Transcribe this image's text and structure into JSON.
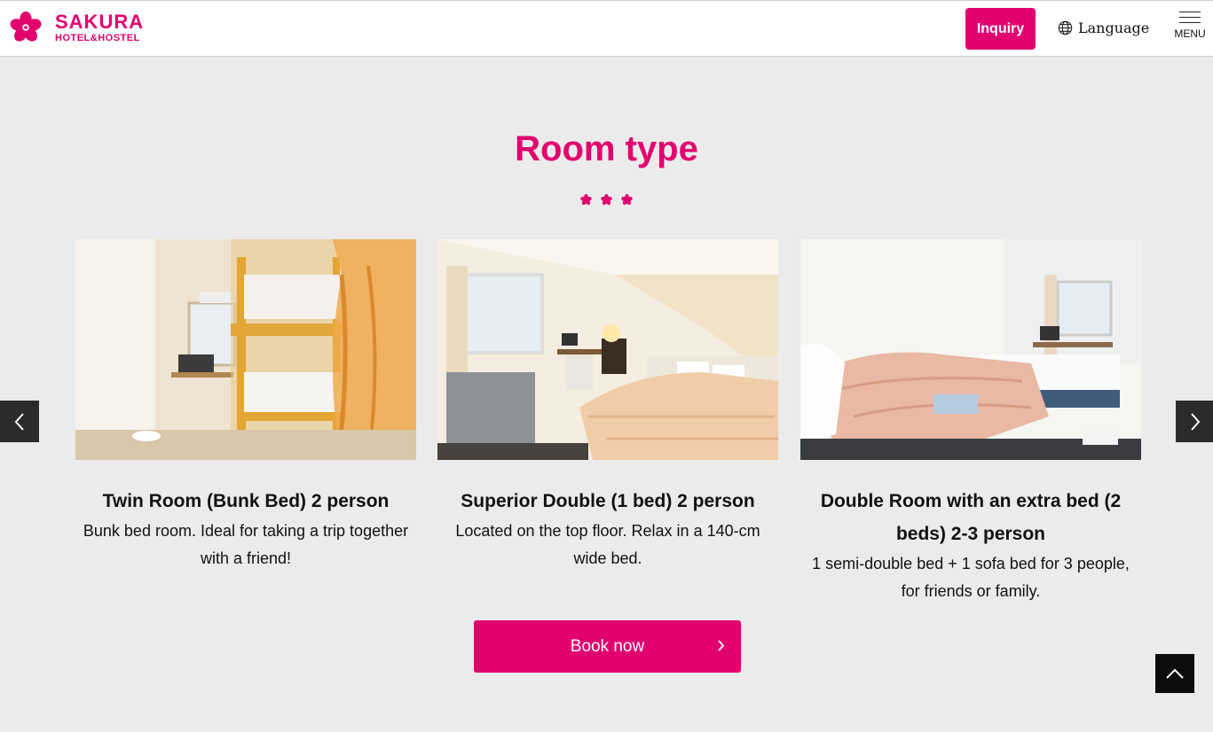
{
  "header": {
    "brand_main": "SAKURA",
    "brand_sub": "HOTEL&HOSTEL",
    "inquiry_label": "Inquiry",
    "language_label": "Language",
    "menu_label": "MENU"
  },
  "section": {
    "title": "Room type"
  },
  "rooms": [
    {
      "title": "Twin Room (Bunk Bed) 2 person",
      "description": "Bunk bed room. Ideal for taking a trip together with a friend!"
    },
    {
      "title": "Superior Double (1 bed) 2 person",
      "description": "Located on the top floor. Relax in a 140-cm wide bed."
    },
    {
      "title": "Double Room with an extra bed (2 beds) 2-3 person",
      "description": "1 semi-double bed + 1 sofa bed for 3 people, for friends or family."
    }
  ],
  "book_now_label": "Book now",
  "colors": {
    "brand": "#e2006f",
    "background": "#ebebeb",
    "dark": "#2b2b2b"
  }
}
